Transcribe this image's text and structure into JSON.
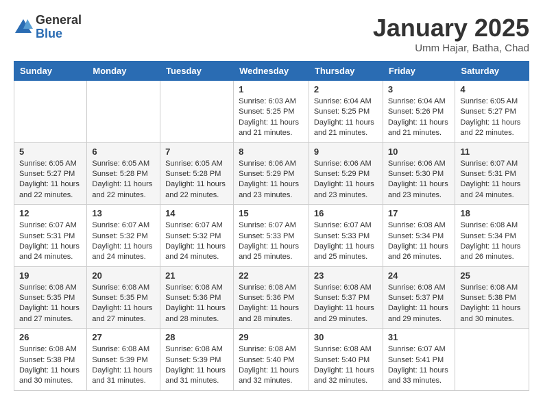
{
  "header": {
    "logo_general": "General",
    "logo_blue": "Blue",
    "month_title": "January 2025",
    "location": "Umm Hajar, Batha, Chad"
  },
  "weekdays": [
    "Sunday",
    "Monday",
    "Tuesday",
    "Wednesday",
    "Thursday",
    "Friday",
    "Saturday"
  ],
  "weeks": [
    [
      {
        "day": "",
        "sunrise": "",
        "sunset": "",
        "daylight": ""
      },
      {
        "day": "",
        "sunrise": "",
        "sunset": "",
        "daylight": ""
      },
      {
        "day": "",
        "sunrise": "",
        "sunset": "",
        "daylight": ""
      },
      {
        "day": "1",
        "sunrise": "Sunrise: 6:03 AM",
        "sunset": "Sunset: 5:25 PM",
        "daylight": "Daylight: 11 hours and 21 minutes."
      },
      {
        "day": "2",
        "sunrise": "Sunrise: 6:04 AM",
        "sunset": "Sunset: 5:25 PM",
        "daylight": "Daylight: 11 hours and 21 minutes."
      },
      {
        "day": "3",
        "sunrise": "Sunrise: 6:04 AM",
        "sunset": "Sunset: 5:26 PM",
        "daylight": "Daylight: 11 hours and 21 minutes."
      },
      {
        "day": "4",
        "sunrise": "Sunrise: 6:05 AM",
        "sunset": "Sunset: 5:27 PM",
        "daylight": "Daylight: 11 hours and 22 minutes."
      }
    ],
    [
      {
        "day": "5",
        "sunrise": "Sunrise: 6:05 AM",
        "sunset": "Sunset: 5:27 PM",
        "daylight": "Daylight: 11 hours and 22 minutes."
      },
      {
        "day": "6",
        "sunrise": "Sunrise: 6:05 AM",
        "sunset": "Sunset: 5:28 PM",
        "daylight": "Daylight: 11 hours and 22 minutes."
      },
      {
        "day": "7",
        "sunrise": "Sunrise: 6:05 AM",
        "sunset": "Sunset: 5:28 PM",
        "daylight": "Daylight: 11 hours and 22 minutes."
      },
      {
        "day": "8",
        "sunrise": "Sunrise: 6:06 AM",
        "sunset": "Sunset: 5:29 PM",
        "daylight": "Daylight: 11 hours and 23 minutes."
      },
      {
        "day": "9",
        "sunrise": "Sunrise: 6:06 AM",
        "sunset": "Sunset: 5:29 PM",
        "daylight": "Daylight: 11 hours and 23 minutes."
      },
      {
        "day": "10",
        "sunrise": "Sunrise: 6:06 AM",
        "sunset": "Sunset: 5:30 PM",
        "daylight": "Daylight: 11 hours and 23 minutes."
      },
      {
        "day": "11",
        "sunrise": "Sunrise: 6:07 AM",
        "sunset": "Sunset: 5:31 PM",
        "daylight": "Daylight: 11 hours and 24 minutes."
      }
    ],
    [
      {
        "day": "12",
        "sunrise": "Sunrise: 6:07 AM",
        "sunset": "Sunset: 5:31 PM",
        "daylight": "Daylight: 11 hours and 24 minutes."
      },
      {
        "day": "13",
        "sunrise": "Sunrise: 6:07 AM",
        "sunset": "Sunset: 5:32 PM",
        "daylight": "Daylight: 11 hours and 24 minutes."
      },
      {
        "day": "14",
        "sunrise": "Sunrise: 6:07 AM",
        "sunset": "Sunset: 5:32 PM",
        "daylight": "Daylight: 11 hours and 24 minutes."
      },
      {
        "day": "15",
        "sunrise": "Sunrise: 6:07 AM",
        "sunset": "Sunset: 5:33 PM",
        "daylight": "Daylight: 11 hours and 25 minutes."
      },
      {
        "day": "16",
        "sunrise": "Sunrise: 6:07 AM",
        "sunset": "Sunset: 5:33 PM",
        "daylight": "Daylight: 11 hours and 25 minutes."
      },
      {
        "day": "17",
        "sunrise": "Sunrise: 6:08 AM",
        "sunset": "Sunset: 5:34 PM",
        "daylight": "Daylight: 11 hours and 26 minutes."
      },
      {
        "day": "18",
        "sunrise": "Sunrise: 6:08 AM",
        "sunset": "Sunset: 5:34 PM",
        "daylight": "Daylight: 11 hours and 26 minutes."
      }
    ],
    [
      {
        "day": "19",
        "sunrise": "Sunrise: 6:08 AM",
        "sunset": "Sunset: 5:35 PM",
        "daylight": "Daylight: 11 hours and 27 minutes."
      },
      {
        "day": "20",
        "sunrise": "Sunrise: 6:08 AM",
        "sunset": "Sunset: 5:35 PM",
        "daylight": "Daylight: 11 hours and 27 minutes."
      },
      {
        "day": "21",
        "sunrise": "Sunrise: 6:08 AM",
        "sunset": "Sunset: 5:36 PM",
        "daylight": "Daylight: 11 hours and 28 minutes."
      },
      {
        "day": "22",
        "sunrise": "Sunrise: 6:08 AM",
        "sunset": "Sunset: 5:36 PM",
        "daylight": "Daylight: 11 hours and 28 minutes."
      },
      {
        "day": "23",
        "sunrise": "Sunrise: 6:08 AM",
        "sunset": "Sunset: 5:37 PM",
        "daylight": "Daylight: 11 hours and 29 minutes."
      },
      {
        "day": "24",
        "sunrise": "Sunrise: 6:08 AM",
        "sunset": "Sunset: 5:37 PM",
        "daylight": "Daylight: 11 hours and 29 minutes."
      },
      {
        "day": "25",
        "sunrise": "Sunrise: 6:08 AM",
        "sunset": "Sunset: 5:38 PM",
        "daylight": "Daylight: 11 hours and 30 minutes."
      }
    ],
    [
      {
        "day": "26",
        "sunrise": "Sunrise: 6:08 AM",
        "sunset": "Sunset: 5:38 PM",
        "daylight": "Daylight: 11 hours and 30 minutes."
      },
      {
        "day": "27",
        "sunrise": "Sunrise: 6:08 AM",
        "sunset": "Sunset: 5:39 PM",
        "daylight": "Daylight: 11 hours and 31 minutes."
      },
      {
        "day": "28",
        "sunrise": "Sunrise: 6:08 AM",
        "sunset": "Sunset: 5:39 PM",
        "daylight": "Daylight: 11 hours and 31 minutes."
      },
      {
        "day": "29",
        "sunrise": "Sunrise: 6:08 AM",
        "sunset": "Sunset: 5:40 PM",
        "daylight": "Daylight: 11 hours and 32 minutes."
      },
      {
        "day": "30",
        "sunrise": "Sunrise: 6:08 AM",
        "sunset": "Sunset: 5:40 PM",
        "daylight": "Daylight: 11 hours and 32 minutes."
      },
      {
        "day": "31",
        "sunrise": "Sunrise: 6:07 AM",
        "sunset": "Sunset: 5:41 PM",
        "daylight": "Daylight: 11 hours and 33 minutes."
      },
      {
        "day": "",
        "sunrise": "",
        "sunset": "",
        "daylight": ""
      }
    ]
  ]
}
